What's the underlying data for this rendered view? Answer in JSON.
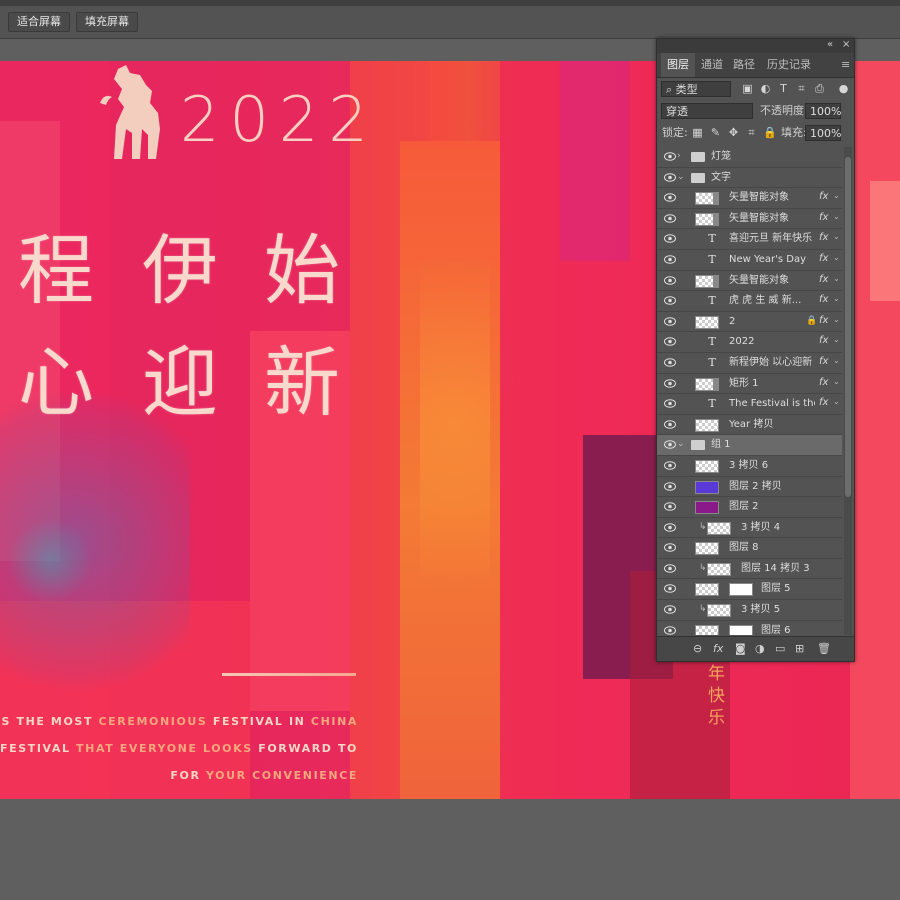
{
  "toolbar": {
    "fit_screen": "适合屏幕",
    "fill_screen": "填充屏幕"
  },
  "artwork": {
    "year": "2022",
    "line1": [
      "程",
      "伊",
      "始"
    ],
    "line2": [
      "心",
      "迎",
      "新"
    ],
    "eng1a": "STIVAL IS THE MOST ",
    "eng1b": "CEREMONIOUS",
    "eng1c": " FESTIVAL IN ",
    "eng1d": "CHINA",
    "eng2a": "ALSO A FESTIVAL ",
    "eng2b": "THAT EVERYONE LOOKS",
    "eng2c": " FORWARD TO",
    "eng3a": "FOR ",
    "eng3b": "YOUR CONVENIENCE",
    "vert": [
      "年",
      "快",
      "乐"
    ]
  },
  "panel": {
    "tabs": [
      "图层",
      "通道",
      "路径",
      "历史记录"
    ],
    "filter_kind": "类型",
    "blend_mode": "穿透",
    "opacity_label": "不透明度:",
    "opacity_value": "100%",
    "lock_label": "锁定:",
    "fill_label": "填充:",
    "fill_value": "100%",
    "layers": [
      {
        "name": "灯笼",
        "kind": "group",
        "indent": 0,
        "expanded": false,
        "fx": false
      },
      {
        "name": "文字",
        "kind": "group",
        "indent": 0,
        "expanded": true,
        "fx": false
      },
      {
        "name": "矢量智能对象",
        "kind": "smart",
        "indent": 1,
        "fx": true
      },
      {
        "name": "矢量智能对象",
        "kind": "smart",
        "indent": 1,
        "fx": true
      },
      {
        "name": "喜迎元旦 新年快乐",
        "kind": "text",
        "indent": 1,
        "fx": true
      },
      {
        "name": "New Year's Day",
        "kind": "text",
        "indent": 1,
        "fx": true
      },
      {
        "name": "矢量智能对象",
        "kind": "smart",
        "indent": 1,
        "fx": true
      },
      {
        "name": "虎 虎 生 威 新...",
        "kind": "text",
        "indent": 1,
        "fx": true
      },
      {
        "name": "2",
        "kind": "pixel",
        "indent": 1,
        "fx": true,
        "locked": true
      },
      {
        "name": "2022",
        "kind": "text",
        "indent": 1,
        "fx": true
      },
      {
        "name": "新程伊始 以心迎新",
        "kind": "text",
        "indent": 1,
        "fx": true
      },
      {
        "name": "矩形 1",
        "kind": "shape",
        "indent": 1,
        "fx": true
      },
      {
        "name": "The Festival is the ...",
        "kind": "text",
        "indent": 1,
        "fx": true
      },
      {
        "name": "Year 拷贝",
        "kind": "pixel",
        "indent": 1,
        "fx": false
      },
      {
        "name": "组 1",
        "kind": "group",
        "indent": 0,
        "expanded": true,
        "fx": false,
        "selected": true
      },
      {
        "name": "3 拷贝 6",
        "kind": "pixel",
        "indent": 1,
        "fx": false
      },
      {
        "name": "图层 2 拷贝",
        "kind": "pixel-blue",
        "indent": 1,
        "fx": false
      },
      {
        "name": "图层 2",
        "kind": "pixel-purple",
        "indent": 1,
        "fx": false
      },
      {
        "name": "3 拷贝 4",
        "kind": "clip",
        "indent": 2,
        "fx": false
      },
      {
        "name": "图层 8",
        "kind": "pixel",
        "indent": 1,
        "fx": false
      },
      {
        "name": "图层 14 拷贝 3",
        "kind": "clip",
        "indent": 2,
        "fx": false
      },
      {
        "name": "图层 5",
        "kind": "masked",
        "indent": 1,
        "fx": false
      },
      {
        "name": "3 拷贝 5",
        "kind": "clip",
        "indent": 2,
        "fx": false
      },
      {
        "name": "图层 6",
        "kind": "masked",
        "indent": 1,
        "fx": false
      }
    ]
  },
  "colors": {
    "accent": "#ef2a56",
    "panel_bg": "#535353",
    "text_gold": "#f8d9cc"
  }
}
